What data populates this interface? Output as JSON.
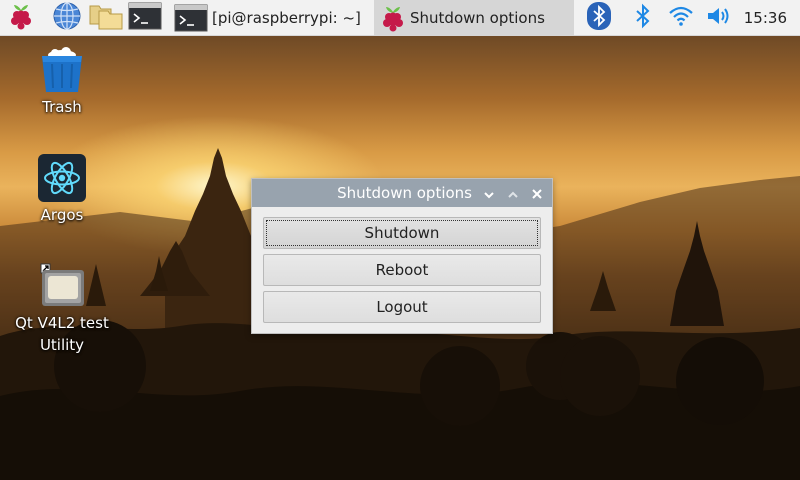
{
  "taskbar": {
    "launchers": [
      {
        "name": "raspberry-menu",
        "icon": "raspberry-icon"
      },
      {
        "name": "web-browser",
        "icon": "globe-icon"
      },
      {
        "name": "file-manager",
        "icon": "folders-icon"
      },
      {
        "name": "terminal",
        "icon": "terminal-icon"
      }
    ],
    "tasks": [
      {
        "label": "[pi@raspberrypi: ~]",
        "icon": "terminal-icon",
        "active": false
      },
      {
        "label": "Shutdown options",
        "icon": "raspberry-icon",
        "active": true
      }
    ],
    "tray": [
      {
        "icon": "bluetooth-app-icon"
      },
      {
        "icon": "bluetooth-icon"
      },
      {
        "icon": "wifi-icon"
      },
      {
        "icon": "volume-icon"
      }
    ],
    "clock": "15:36"
  },
  "desktop_icons": [
    {
      "label": "Trash",
      "icon": "trash-icon"
    },
    {
      "label": "Argos",
      "icon": "atom-icon"
    },
    {
      "label": "Qt V4L2 test Utility",
      "icon": "camera-utility-icon"
    }
  ],
  "dialog": {
    "title": "Shutdown options",
    "buttons": [
      "Shutdown",
      "Reboot",
      "Logout"
    ],
    "focused_button": "Shutdown"
  },
  "colors": {
    "taskbar_bg": "#f2f2f2",
    "active_task_bg": "#d6d6d6",
    "dialog_titlebar": "#98a3ae",
    "dialog_bg": "#ededed",
    "raspberry_red": "#c51a4a",
    "leaf_green": "#6cc04a",
    "tray_blue": "#1e88e5"
  }
}
